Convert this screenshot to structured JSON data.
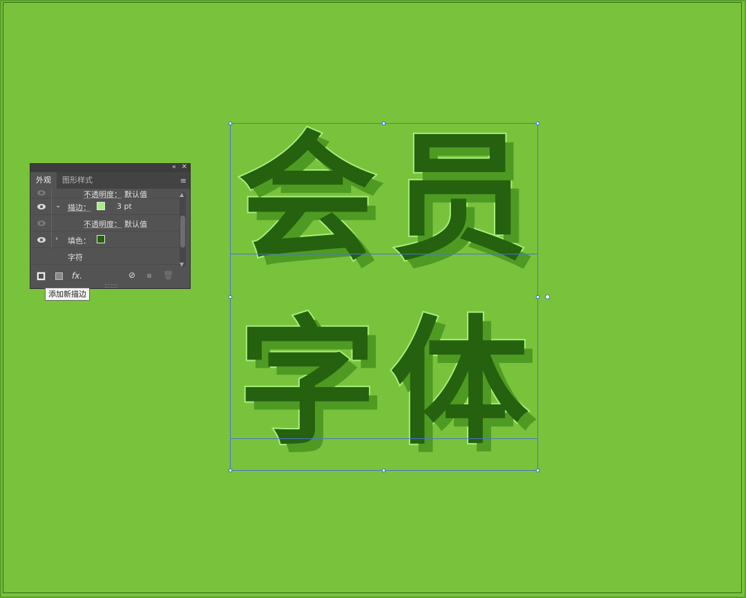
{
  "canvas": {
    "glyphs": [
      "会",
      "员",
      "字",
      "体"
    ]
  },
  "panel": {
    "tabs": [
      {
        "label": "外观",
        "active": true
      },
      {
        "label": "图形样式",
        "active": false
      }
    ],
    "collapse_icon": "«",
    "close_icon": "✕",
    "menu_icon": "≡",
    "rows": {
      "opacity1": {
        "label": "不透明度：",
        "value": "默认值"
      },
      "stroke": {
        "label": "描边：",
        "weight": "3 pt",
        "swatch_color": "#a5f17a"
      },
      "opacity2": {
        "label": "不透明度：",
        "value": "默认值"
      },
      "fill": {
        "label": "填色：",
        "swatch_color": "#25610f"
      },
      "character": {
        "label": "字符"
      }
    },
    "toolbar": {
      "fx_label": "fx."
    }
  },
  "tooltip": "添加新描边",
  "colors": {
    "background": "#79c23c",
    "glyph_fill": "#25610f",
    "glyph_stroke": "#a5f17a",
    "glyph_shadow": "#4f9a23",
    "panel_bg": "#535353"
  }
}
